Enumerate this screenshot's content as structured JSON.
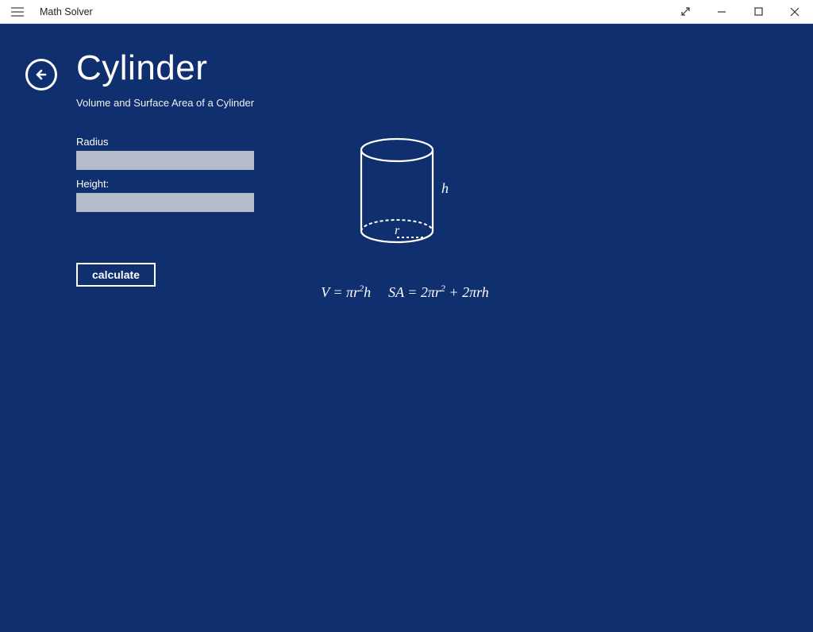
{
  "window": {
    "title": "Math Solver"
  },
  "page": {
    "title": "Cylinder",
    "subtitle": "Volume and Surface Area of a Cylinder"
  },
  "form": {
    "radius_label": "Radius",
    "radius_value": "",
    "height_label": "Height:",
    "height_value": "",
    "calculate_label": "calculate"
  },
  "diagram": {
    "h_label": "h",
    "r_label": "r",
    "formula_volume": "V = πr²h",
    "formula_surface": "SA = 2πr² + 2πrh"
  },
  "icons": {
    "hamburger": "hamburger-icon",
    "back": "back-arrow-icon",
    "fullscreen": "fullscreen-icon",
    "minimize": "minimize-icon",
    "maximize": "maximize-icon",
    "close": "close-icon"
  },
  "colors": {
    "app_bg": "#0f2f6f",
    "input_bg": "#b4bccb"
  }
}
